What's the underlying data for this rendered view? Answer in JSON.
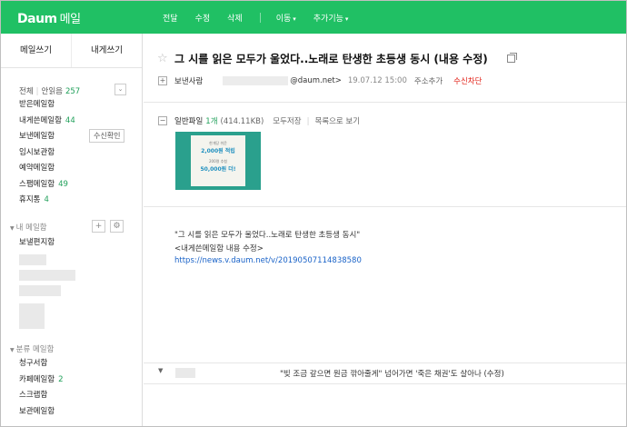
{
  "topbar": {
    "logo": "Daum",
    "logo_sub": "메일",
    "nav": [
      "전달",
      "수정",
      "삭제",
      "이동",
      "추가기능"
    ],
    "accent_color": "#20c064"
  },
  "sidebar": {
    "tabs": [
      "메일쓰기",
      "내게쓰기"
    ],
    "total_label": "전체",
    "unread_label": "안읽음",
    "unread_count": "257",
    "folders": [
      {
        "label": "받은메일함",
        "count": ""
      },
      {
        "label": "내게쓴메일함",
        "count": "44"
      },
      {
        "label": "보낸메일함",
        "count": ""
      },
      {
        "label": "임시보관함",
        "count": ""
      },
      {
        "label": "예약메일함",
        "count": ""
      },
      {
        "label": "스팸메일함",
        "count": "49"
      },
      {
        "label": "휴지통",
        "count": "4"
      }
    ],
    "receipt_check": "수신확인",
    "my_section": "내 메일함",
    "my_folders": [
      {
        "label": "보낼편지함",
        "count": ""
      }
    ],
    "category_section": "분류 메일함",
    "category_folders": [
      {
        "label": "청구서함",
        "count": ""
      },
      {
        "label": "카페메일함",
        "count": "2"
      },
      {
        "label": "스크랩함",
        "count": ""
      },
      {
        "label": "보관메일함",
        "count": ""
      }
    ]
  },
  "mail": {
    "subject": "그 시를 읽은 모두가 울었다..노래로 탄생한 초등생 동시 (내용 수정)",
    "sender_label": "보낸사람",
    "sender_domain": "@daum.net>",
    "date": "19.07.12 15:00",
    "add_contact": "주소추가",
    "block": "수신차단",
    "attach_label": "일반파일",
    "attach_count": "1개",
    "attach_size": "(414.11KB)",
    "save_all": "모두저장",
    "list_view": "목록으로 보기",
    "thumb": {
      "line1": "한개당 쉬운",
      "line2": "2,000원 적립",
      "line3": "200명 추첨",
      "line4": "50,000원 더!"
    },
    "body_line1": "\"그 시를 읽은 모두가 울었다..노래로 탄생한 초등생 동시\"",
    "body_line2": "<내게쓴메일함 내용 수정>",
    "body_link": "https://news.v.daum.net/v/20190507114838580"
  },
  "next_mail": {
    "subject": "\"빚 조금 갚으면 원금 깎아줄게\" 넘어가면 '죽은 채권'도 살아나 (수정)"
  }
}
